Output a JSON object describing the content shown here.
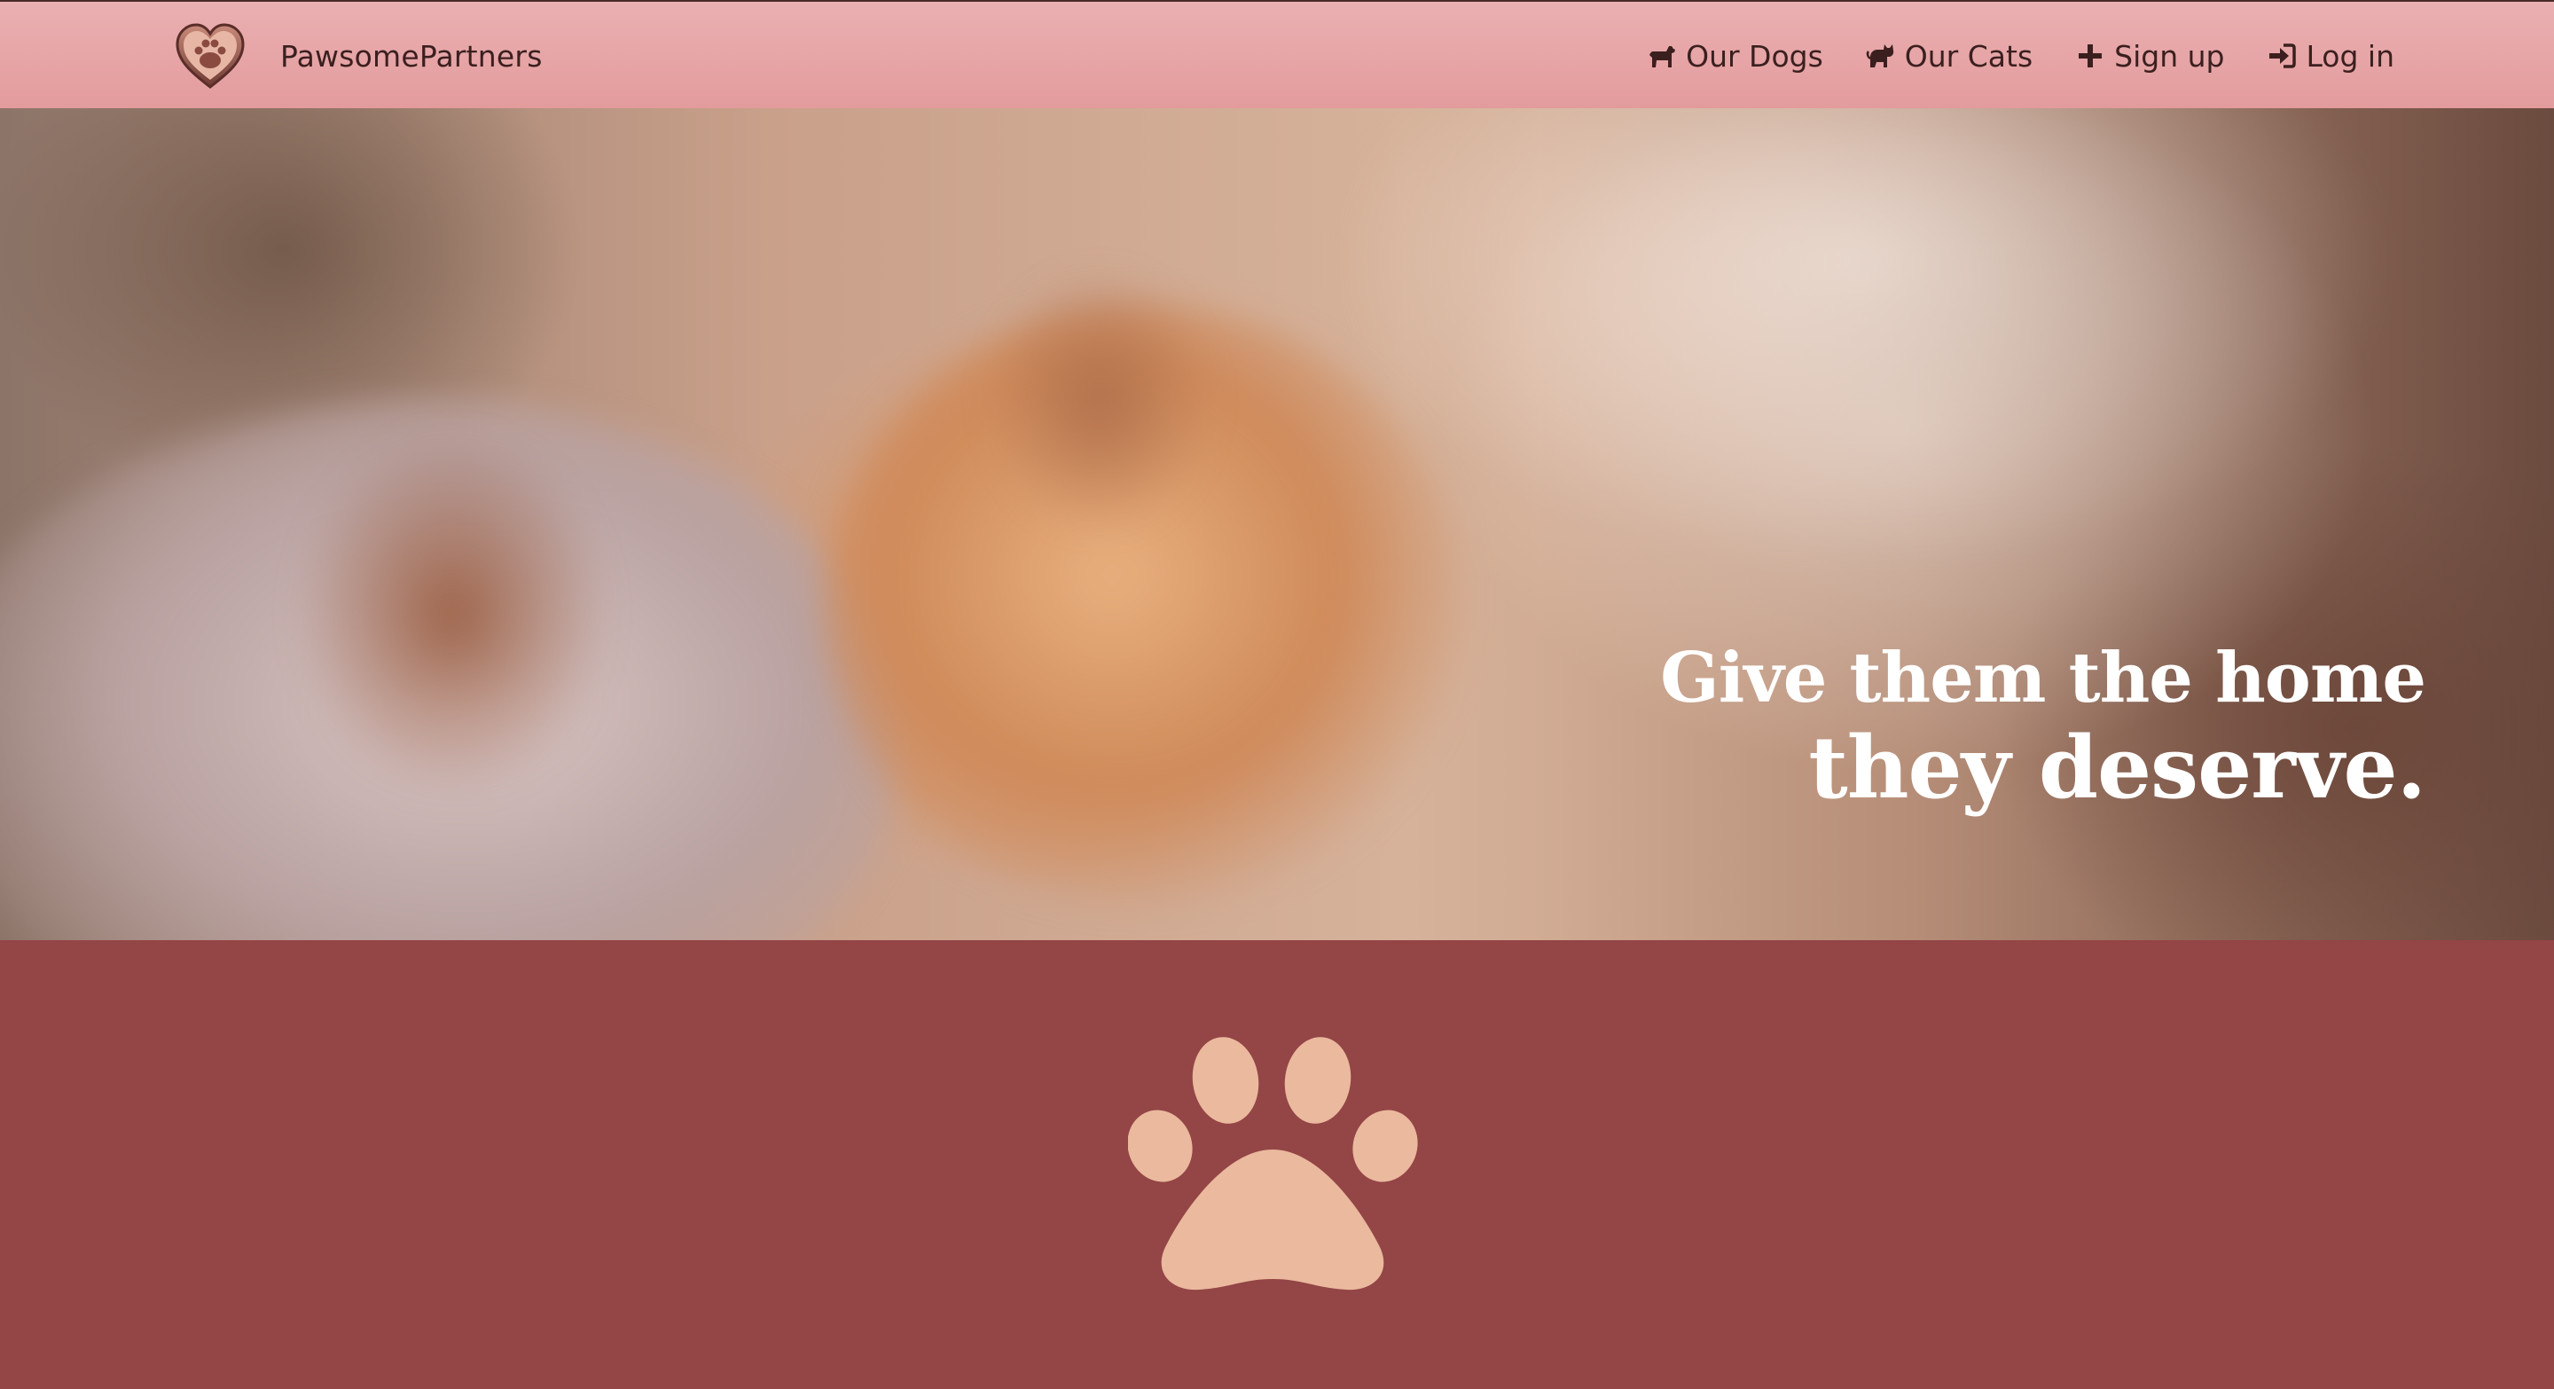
{
  "navbar": {
    "brand_name": "PawsomePartners",
    "logo_icon": "heart-paw-logo",
    "links": [
      {
        "label": "Our Dogs",
        "icon": "dog-icon"
      },
      {
        "label": "Our Cats",
        "icon": "cat-icon"
      },
      {
        "label": "Sign up",
        "icon": "plus-icon"
      },
      {
        "label": "Log in",
        "icon": "sign-in-icon"
      }
    ]
  },
  "hero": {
    "image": "cat-photo",
    "tagline_line1": "Give them the home",
    "tagline_line2": "they deserve."
  },
  "lower_section": {
    "icon": "paw-icon"
  },
  "colors": {
    "navbar": "#e39b9c",
    "section_bg": "#944546",
    "paw": "#eab99e",
    "text_dark": "#3b1f1f"
  }
}
